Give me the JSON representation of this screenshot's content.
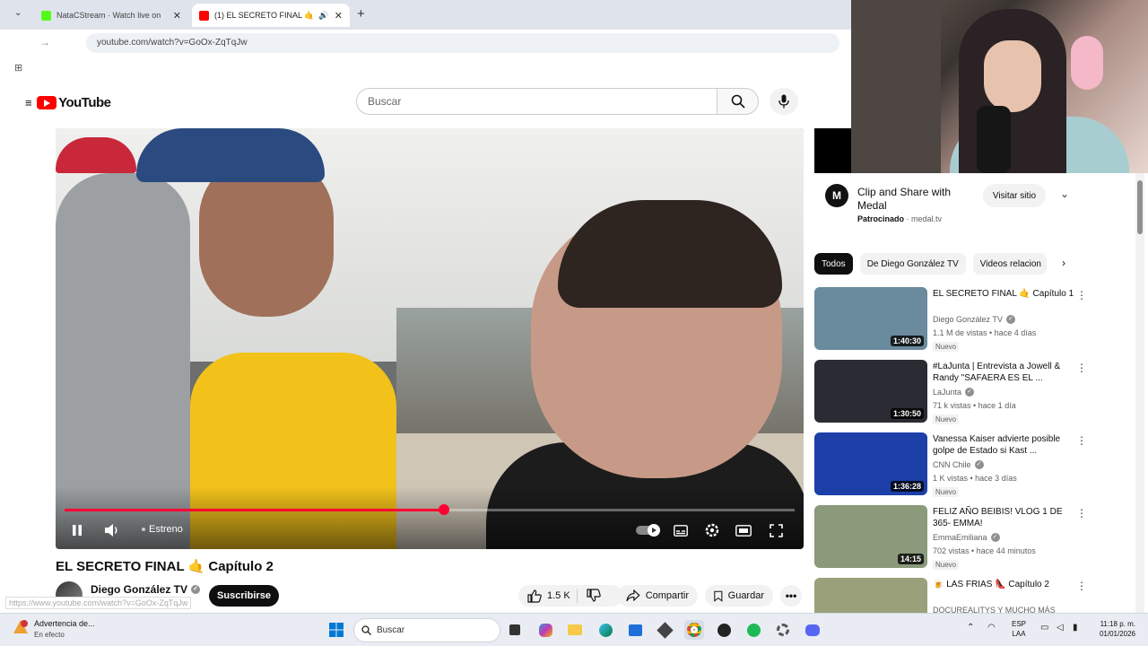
{
  "browser": {
    "tabs": [
      {
        "title": "NataCStream · Watch live on",
        "active": false
      },
      {
        "title": "(1) EL SECRETO FINAL 🤙 Ca",
        "active": true
      }
    ],
    "new_tab_symbol": "+",
    "url": "youtube.com/watch?v=GoOx-ZqTqJw",
    "status_url": "https://www.youtube.com/watch?v=GoOx-ZqTqJw"
  },
  "youtube": {
    "logo_text": "YouTube",
    "search_placeholder": "Buscar"
  },
  "player": {
    "progress_fraction": 0.52,
    "premiere_label": "Estreno"
  },
  "video": {
    "title": "EL SECRETO FINAL 🤙 Capítulo 2",
    "channel": "Diego González TV",
    "subscribe_label": "Suscribirse",
    "likes": "1.5 K",
    "share_label": "Compartir",
    "save_label": "Guardar"
  },
  "ad": {
    "logo_letter": "M",
    "title": "Clip and Share with Medal",
    "sponsored_label": "Patrocinado",
    "domain": "medal.tv",
    "visit_label": "Visitar sitio"
  },
  "chips": [
    "Todos",
    "De Diego González TV",
    "Videos relacion"
  ],
  "recommendations": [
    {
      "title": "EL SECRETO FINAL 🤙 Capítulo 1",
      "channel": "Diego González TV",
      "meta": "1.1 M de vistas • hace 4 días",
      "badge": "Nuevo",
      "duration": "1:40:30",
      "thumb_color": "#6a8a9e"
    },
    {
      "title": "#LaJunta | Entrevista a Jowell & Randy \"SAFAERA ES EL ...",
      "channel": "LaJunta",
      "meta": "71 k vistas • hace 1 día",
      "badge": "Nuevo",
      "duration": "1:30:50",
      "thumb_color": "#2b2b33"
    },
    {
      "title": "Vanessa Kaiser advierte posible golpe de Estado si Kast ...",
      "channel": "CNN Chile",
      "meta": "1 K vistas • hace 3 días",
      "badge": "Nuevo",
      "duration": "1:36:28",
      "thumb_color": "#1c3fa8"
    },
    {
      "title": "FELIZ AÑO BEIBIS! VLOG 1 DE 365- EMMA!",
      "channel": "EmmaEmiliana",
      "meta": "702 vistas • hace 44 minutos",
      "badge": "Nuevo",
      "duration": "14:15",
      "thumb_color": "#8a9a7a"
    },
    {
      "title": "🍺 LAS FRIAS 👠 Capítulo 2",
      "channel": "DOCUREALITYS Y MUCHO MÁS",
      "meta": "",
      "badge": "",
      "duration": "",
      "thumb_color": "#9aa07a"
    }
  ],
  "taskbar": {
    "notification_title": "Advertencia de...",
    "notification_sub": "En efecto",
    "search_label": "Buscar",
    "lang_line1": "ESP",
    "lang_line2": "LAA",
    "time": "11:18 p. m.",
    "date": "01/01/2026"
  }
}
